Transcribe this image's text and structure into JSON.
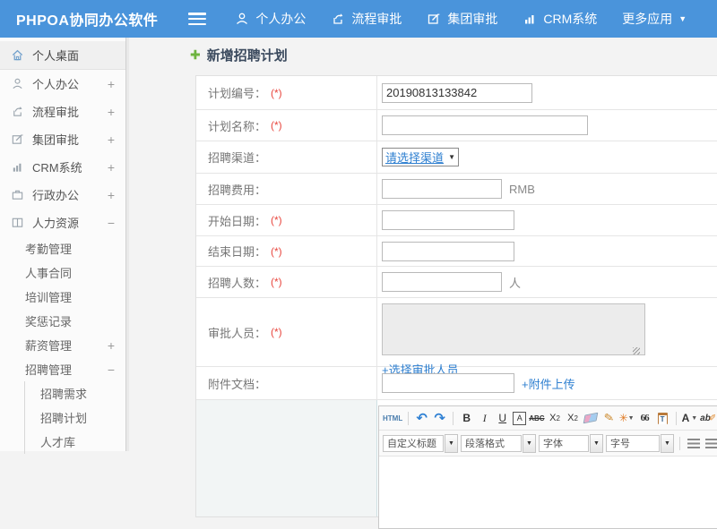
{
  "topbar": {
    "brand": "PHPOA协同办公软件",
    "menu": [
      {
        "label": "个人办公"
      },
      {
        "label": "流程审批"
      },
      {
        "label": "集团审批"
      },
      {
        "label": "CRM系统"
      },
      {
        "label": "更多应用"
      }
    ]
  },
  "sidebar": {
    "desktop": {
      "label": "个人桌面"
    },
    "items": [
      {
        "label": "个人办公",
        "toggle": "+"
      },
      {
        "label": "流程审批",
        "toggle": "+"
      },
      {
        "label": "集团审批",
        "toggle": "+"
      },
      {
        "label": "CRM系统",
        "toggle": "+"
      },
      {
        "label": "行政办公",
        "toggle": "+"
      },
      {
        "label": "人力资源",
        "toggle": "−"
      }
    ],
    "hr_children": [
      {
        "label": "考勤管理",
        "toggle": ""
      },
      {
        "label": "人事合同",
        "toggle": ""
      },
      {
        "label": "培训管理",
        "toggle": ""
      },
      {
        "label": "奖惩记录",
        "toggle": ""
      },
      {
        "label": "薪资管理",
        "toggle": "+"
      },
      {
        "label": "招聘管理",
        "toggle": "−"
      }
    ],
    "recruit_children": [
      {
        "label": "招聘需求"
      },
      {
        "label": "招聘计划"
      },
      {
        "label": "人才库"
      }
    ]
  },
  "main": {
    "title": "新增招聘计划",
    "required_mark": "(*)",
    "form": {
      "rows": [
        {
          "label": "计划编号：",
          "required": true,
          "value": "20190813133842"
        },
        {
          "label": "计划名称：",
          "required": true
        },
        {
          "label": "招聘渠道：",
          "required": false,
          "select_value": "请选择渠道"
        },
        {
          "label": "招聘费用：",
          "required": false,
          "suffix": "RMB"
        },
        {
          "label": "开始日期：",
          "required": true
        },
        {
          "label": "结束日期：",
          "required": true
        },
        {
          "label": "招聘人数：",
          "required": true,
          "suffix": "人"
        },
        {
          "label": "审批人员：",
          "required": true,
          "link": "+选择审批人员"
        },
        {
          "label": "附件文档：",
          "required": false,
          "link": "+附件上传"
        }
      ]
    },
    "editor": {
      "html_button": "HTML",
      "bold": "B",
      "italic": "I",
      "underline": "U",
      "border_a": "A",
      "strike": "ABC",
      "sup": "X",
      "sup_mark": "2",
      "sub": "X",
      "sub_mark": "2",
      "quote": "66",
      "paste_letter": "T",
      "font_color": "A",
      "highlight": "ab",
      "combos": [
        {
          "label": "自定义标题"
        },
        {
          "label": "段落格式"
        },
        {
          "label": "字体"
        },
        {
          "label": "字号"
        }
      ]
    }
  },
  "icons": {
    "undo": "↶",
    "redo": "↷",
    "caret_down": "▼",
    "combo_caret": "▼",
    "plus_green": "✚",
    "brush": "✎",
    "sparkle": "✳",
    "pen": "✐",
    "chain": "∞"
  },
  "colors": {
    "topbar_blue": "#4a94db",
    "link_blue": "#2e7fd0",
    "required_red": "#e8473f",
    "title_navy": "#3b4a5e",
    "plus_green": "#6db33f"
  }
}
